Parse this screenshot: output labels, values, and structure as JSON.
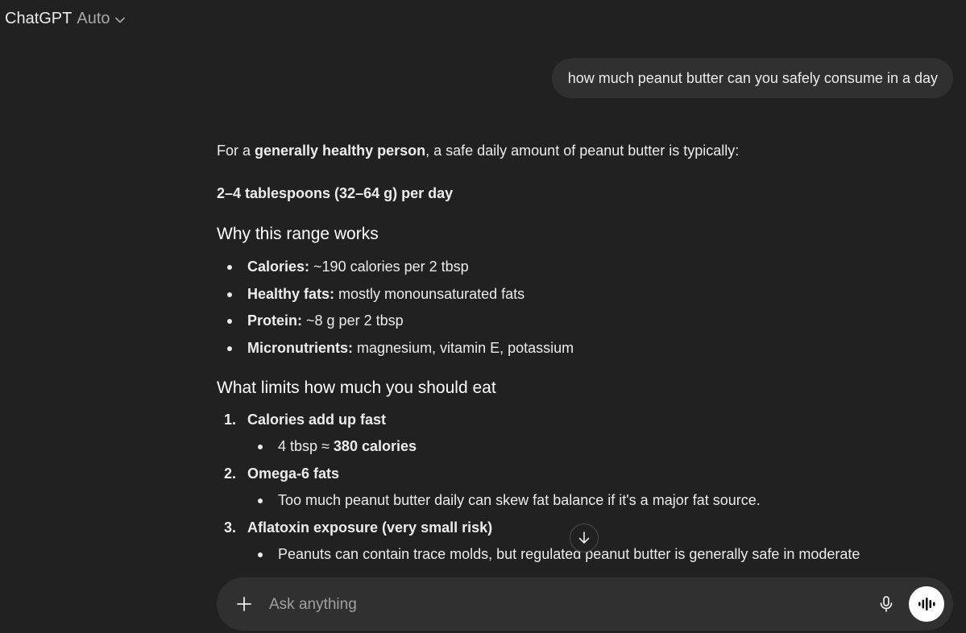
{
  "header": {
    "model_name": "ChatGPT",
    "model_mode": "Auto",
    "chevron_icon": "chevron-down-icon"
  },
  "user_message": "how much peanut butter can you safely consume in a day",
  "answer": {
    "intro_prefix": "For a ",
    "intro_bold": "generally healthy person",
    "intro_suffix": ", a safe daily amount of peanut butter is typically:",
    "range": "2–4 tablespoons (32–64 g) per day",
    "why_heading": "Why this range works",
    "why_items": [
      {
        "label": "Calories:",
        "text": " ~190 calories per 2 tbsp"
      },
      {
        "label": "Healthy fats:",
        "text": " mostly monounsaturated fats"
      },
      {
        "label": "Protein:",
        "text": " ~8 g per 2 tbsp"
      },
      {
        "label": "Micronutrients:",
        "text": " magnesium, vitamin E, potassium"
      }
    ],
    "limits_heading": "What limits how much you should eat",
    "limits": [
      {
        "num": "1.",
        "title": "Calories add up fast",
        "sub_prefix": "4 tbsp ≈ ",
        "sub_bold": "380 calories"
      },
      {
        "num": "2.",
        "title": "Omega-6 fats",
        "sub_prefix": "Too much peanut butter daily can skew fat balance if it's a major fat source.",
        "sub_bold": ""
      },
      {
        "num": "3.",
        "title": "Aflatoxin exposure (very small risk)",
        "sub_prefix": "Peanuts can contain trace molds, but regulated peanut butter is generally safe in moderate",
        "sub_bold": ""
      }
    ]
  },
  "composer": {
    "placeholder": "Ask anything",
    "plus_icon": "plus-icon",
    "mic_icon": "microphone-icon",
    "voice_icon": "voice-waveform-icon"
  },
  "scroll_icon": "arrow-down-icon",
  "colors": {
    "background": "#212121",
    "bubble": "#303030",
    "text": "#ececec"
  }
}
